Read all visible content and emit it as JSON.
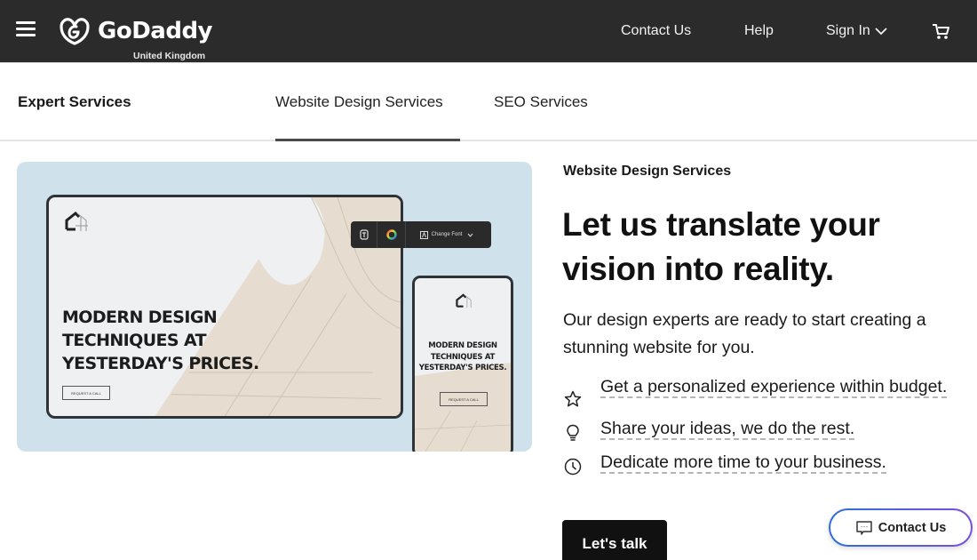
{
  "header": {
    "brand": "GoDaddy",
    "region": "United Kingdom",
    "nav": {
      "contact": "Contact Us",
      "help": "Help",
      "sign_in": "Sign In"
    },
    "icons": [
      "hamburger-menu-icon",
      "godaddy-logo-icon",
      "chevron-down-icon",
      "shopping-cart-icon"
    ]
  },
  "subnav": {
    "title": "Expert Services",
    "tabs": [
      {
        "label": "Website Design Services",
        "active": true
      },
      {
        "label": "SEO Services",
        "active": false
      }
    ]
  },
  "hero_image": {
    "desktop_headline": "MODERN DESIGN\nTECHNIQUES AT\nYESTERDAY'S PRICES.",
    "desktop_button": "REQUEST A CALL",
    "phone_headline": "MODERN DESIGN\nTECHNIQUES AT\nYESTERDAY'S PRICES.",
    "phone_button": "REQUEST A CALL",
    "toolbar_font_label": "Change Font",
    "background_color": "#cfe1ea"
  },
  "content": {
    "eyebrow": "Website Design Services",
    "headline": "Let us translate your vision into reality.",
    "intro": "Our design experts are ready to start creating a stunning website for you.",
    "features": [
      {
        "icon": "star-icon",
        "text": "Get a personalized experience within budget."
      },
      {
        "icon": "lightbulb-icon",
        "text": "Share your ideas, we do the rest."
      },
      {
        "icon": "clock-icon",
        "text": "Dedicate more time to your business."
      }
    ],
    "cta": "Let's talk"
  },
  "floating_contact": {
    "label": "Contact Us",
    "icon": "chat-icon",
    "gradient": [
      "#2f6fd6",
      "#7a4fd8"
    ]
  }
}
